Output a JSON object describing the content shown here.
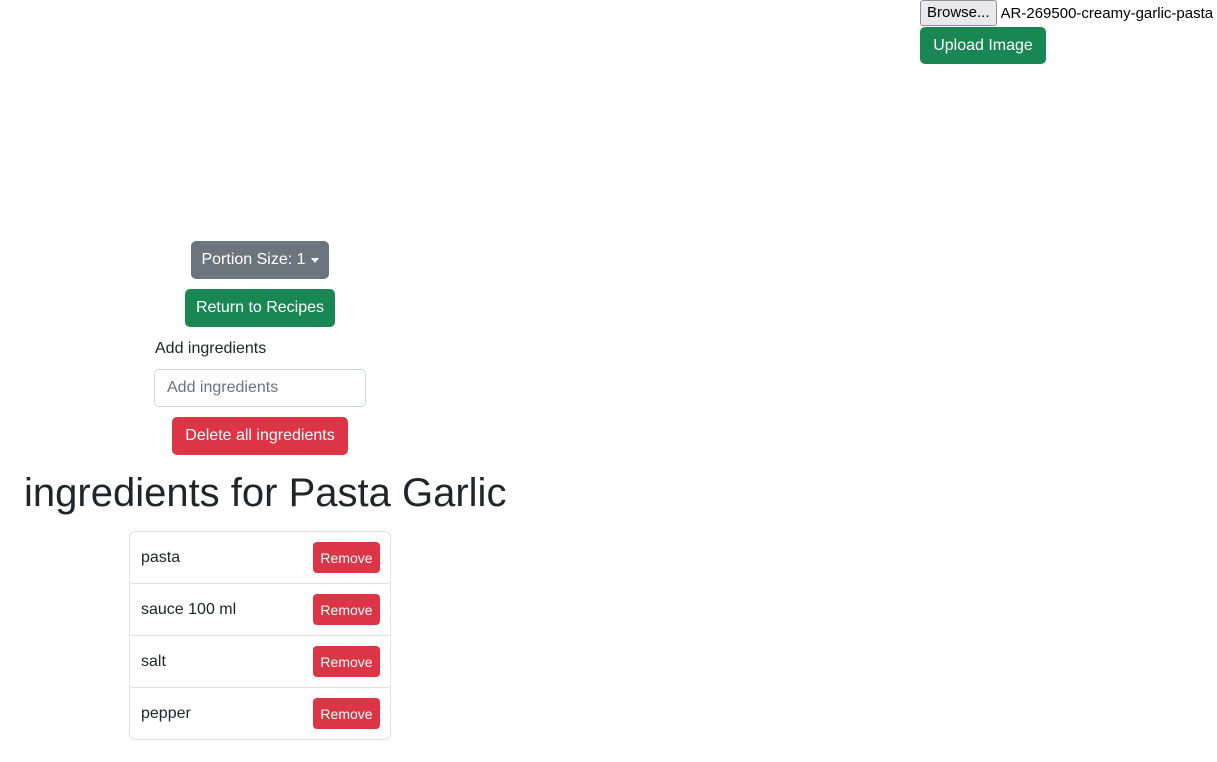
{
  "upload": {
    "browse_label": "Browse...",
    "file_name": "AR-269500-creamy-garlic-pasta",
    "upload_label": "Upload Image"
  },
  "controls": {
    "portion_label": "Portion Size: 1",
    "return_label": "Return to Recipes",
    "add_label": "Add ingredients",
    "add_placeholder": "Add ingredients",
    "delete_all_label": "Delete all ingredients"
  },
  "heading": "ingredients for Pasta Garlic",
  "ingredients": [
    {
      "name": "pasta",
      "remove_label": "Remove"
    },
    {
      "name": "sauce 100 ml",
      "remove_label": "Remove"
    },
    {
      "name": "salt",
      "remove_label": "Remove"
    },
    {
      "name": "pepper",
      "remove_label": "Remove"
    }
  ],
  "colors": {
    "success": "#198754",
    "secondary": "#6c757d",
    "danger": "#dc3545"
  },
  "icons": {
    "portion_caret": "caret-down-icon"
  }
}
